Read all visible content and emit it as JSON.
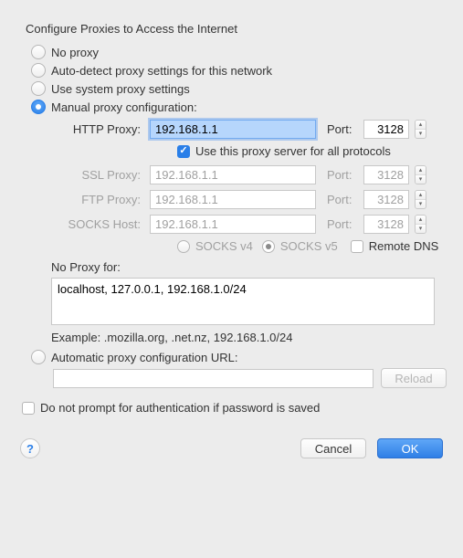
{
  "title": "Configure Proxies to Access the Internet",
  "options": {
    "none": "No proxy",
    "auto": "Auto-detect proxy settings for this network",
    "system": "Use system proxy settings",
    "manual": "Manual proxy configuration:",
    "autocfg": "Automatic proxy configuration URL:"
  },
  "labels": {
    "http": "HTTP Proxy:",
    "ssl": "SSL Proxy:",
    "ftp": "FTP Proxy:",
    "socks": "SOCKS Host:",
    "port": "Port:",
    "useAll": "Use this proxy server for all protocols",
    "socks4": "SOCKS v4",
    "socks5": "SOCKS v5",
    "remoteDns": "Remote DNS",
    "noproxy": "No Proxy for:",
    "example": "Example: .mozilla.org, .net.nz, 192.168.1.0/24",
    "reload": "Reload",
    "noPrompt": "Do not prompt for authentication if password is saved",
    "cancel": "Cancel",
    "ok": "OK",
    "help": "?"
  },
  "values": {
    "httpHost": "192.168.1.1",
    "httpPort": "3128",
    "sslHost": "192.168.1.1",
    "sslPort": "3128",
    "ftpHost": "192.168.1.1",
    "ftpPort": "3128",
    "socksHost": "192.168.1.1",
    "socksPort": "3128",
    "noproxy": "localhost, 127.0.0.1, 192.168.1.0/24",
    "autocfgUrl": ""
  },
  "state": {
    "selectedMode": "manual",
    "useAllChecked": true,
    "socksVersion": "v5",
    "remoteDns": false,
    "noPromptAuth": false
  }
}
